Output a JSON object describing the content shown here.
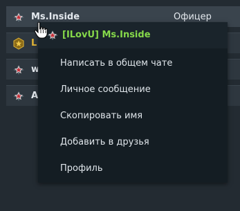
{
  "rows": [
    {
      "name": "Ms.Inside",
      "rank": "Офицер",
      "icon": "star-rank-icon",
      "selected": true
    },
    {
      "name": "L",
      "rank": "",
      "icon": "gold-star-rank-icon"
    },
    {
      "name": "w",
      "rank": "",
      "icon": "star-rank-icon"
    },
    {
      "name": "A",
      "rank": "",
      "icon": "star-rank-icon"
    }
  ],
  "context_menu": {
    "header": "[ILovU] Ms.Inside",
    "items": [
      {
        "label": "Написать в общем чате"
      },
      {
        "label": "Личное сообщение"
      },
      {
        "label": "Скопировать имя"
      },
      {
        "label": "Добавить в друзья"
      },
      {
        "label": "Профиль"
      }
    ]
  },
  "colors": {
    "background": "#232b32",
    "row": "#2e373f",
    "menu": "#141d23",
    "clan_name": "#86d94a",
    "gold_name": "#e2b536",
    "rank_icon_red": "#c6303a"
  }
}
